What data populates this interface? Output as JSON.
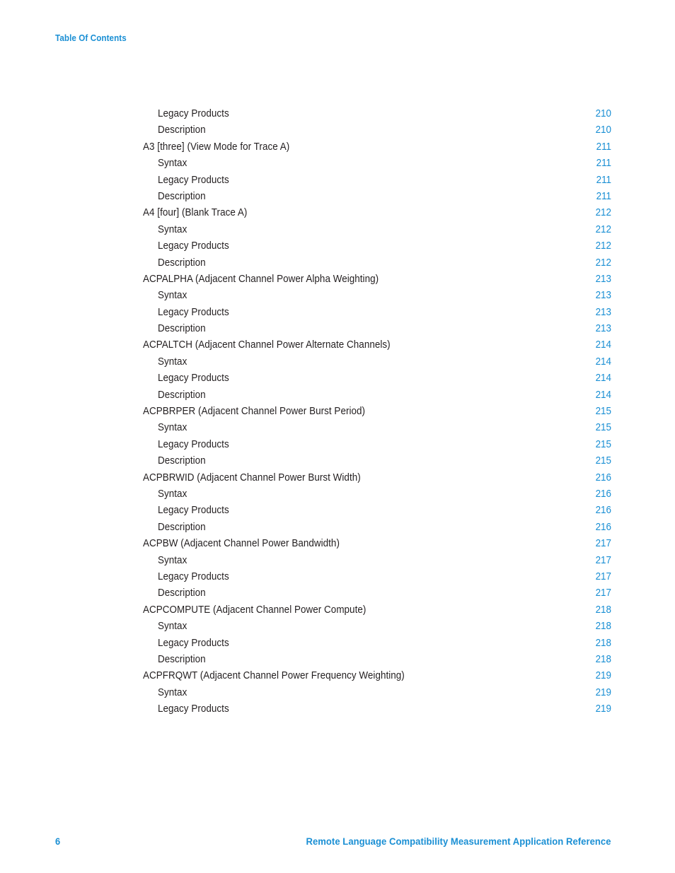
{
  "header": {
    "label": "Table Of Contents"
  },
  "toc": {
    "entries": [
      {
        "level": 2,
        "title": "Legacy Products",
        "page": "210"
      },
      {
        "level": 2,
        "title": "Description",
        "page": "210"
      },
      {
        "level": 1,
        "title": "A3 [three] (View Mode for Trace A)",
        "page": "211"
      },
      {
        "level": 2,
        "title": "Syntax",
        "page": "211"
      },
      {
        "level": 2,
        "title": "Legacy Products",
        "page": "211"
      },
      {
        "level": 2,
        "title": "Description",
        "page": "211"
      },
      {
        "level": 1,
        "title": "A4 [four] (Blank Trace A)",
        "page": "212"
      },
      {
        "level": 2,
        "title": "Syntax",
        "page": "212"
      },
      {
        "level": 2,
        "title": "Legacy Products",
        "page": "212"
      },
      {
        "level": 2,
        "title": "Description",
        "page": "212"
      },
      {
        "level": 1,
        "title": "ACPALPHA (Adjacent Channel Power Alpha Weighting)",
        "page": "213"
      },
      {
        "level": 2,
        "title": "Syntax",
        "page": "213"
      },
      {
        "level": 2,
        "title": "Legacy Products",
        "page": "213"
      },
      {
        "level": 2,
        "title": "Description",
        "page": "213"
      },
      {
        "level": 1,
        "title": "ACPALTCH (Adjacent Channel Power Alternate Channels)",
        "page": "214"
      },
      {
        "level": 2,
        "title": "Syntax",
        "page": "214"
      },
      {
        "level": 2,
        "title": "Legacy Products",
        "page": "214"
      },
      {
        "level": 2,
        "title": "Description",
        "page": "214"
      },
      {
        "level": 1,
        "title": "ACPBRPER (Adjacent Channel Power Burst Period)",
        "page": "215"
      },
      {
        "level": 2,
        "title": "Syntax",
        "page": "215"
      },
      {
        "level": 2,
        "title": "Legacy Products",
        "page": "215"
      },
      {
        "level": 2,
        "title": "Description",
        "page": "215"
      },
      {
        "level": 1,
        "title": "ACPBRWID (Adjacent Channel Power Burst Width)",
        "page": "216"
      },
      {
        "level": 2,
        "title": "Syntax",
        "page": "216"
      },
      {
        "level": 2,
        "title": "Legacy Products",
        "page": "216"
      },
      {
        "level": 2,
        "title": "Description",
        "page": "216"
      },
      {
        "level": 1,
        "title": "ACPBW (Adjacent Channel Power Bandwidth)",
        "page": "217"
      },
      {
        "level": 2,
        "title": "Syntax",
        "page": "217"
      },
      {
        "level": 2,
        "title": "Legacy Products",
        "page": "217"
      },
      {
        "level": 2,
        "title": "Description",
        "page": "217"
      },
      {
        "level": 1,
        "title": "ACPCOMPUTE (Adjacent Channel Power Compute)",
        "page": "218"
      },
      {
        "level": 2,
        "title": "Syntax",
        "page": "218"
      },
      {
        "level": 2,
        "title": "Legacy Products",
        "page": "218"
      },
      {
        "level": 2,
        "title": "Description",
        "page": "218"
      },
      {
        "level": 1,
        "title": "ACPFRQWT (Adjacent Channel Power Frequency Weighting)",
        "page": "219"
      },
      {
        "level": 2,
        "title": "Syntax",
        "page": "219"
      },
      {
        "level": 2,
        "title": "Legacy Products",
        "page": "219"
      }
    ]
  },
  "footer": {
    "page_number": "6",
    "document_title": "Remote Language Compatibility Measurement Application Reference"
  },
  "colors": {
    "accent_blue": "#1a8fd4",
    "body_text": "#231f20",
    "page_background": "#ffffff"
  }
}
